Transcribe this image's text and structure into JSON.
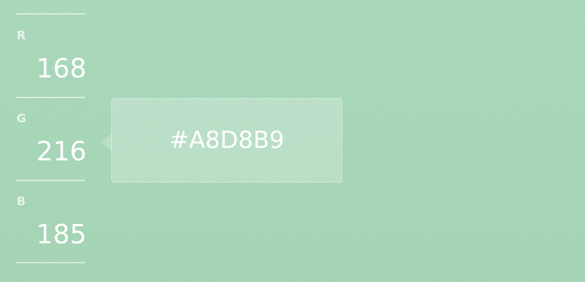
{
  "color": {
    "hex": "#A8D8B9",
    "background": "#a8d8b9"
  },
  "channels": [
    {
      "label": "R",
      "value": "168"
    },
    {
      "label": "G",
      "value": "216"
    },
    {
      "label": "B",
      "value": "185"
    }
  ],
  "tooltip": {
    "text": "#A8D8B9"
  }
}
